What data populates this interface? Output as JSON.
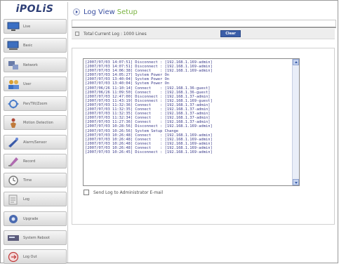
{
  "logo": "iPOLiS",
  "sidebar": {
    "items": [
      {
        "label": "Live",
        "icon": "monitor-icon",
        "color": "#3a6fc4"
      },
      {
        "label": "Basic",
        "icon": "computer-icon",
        "color": "#3d6fbf"
      },
      {
        "label": "Network",
        "icon": "network-icon",
        "color": "#6a7ca8"
      },
      {
        "label": "User",
        "icon": "users-icon",
        "color": "#d9a032"
      },
      {
        "label": "Pan/Tilt/Zoom",
        "icon": "ptz-icon",
        "color": "#4a7cc9"
      },
      {
        "label": "Motion Detection",
        "icon": "motion-icon",
        "color": "#b04a3a"
      },
      {
        "label": "Alarm/Sensor",
        "icon": "alarm-icon",
        "color": "#3a5aa8"
      },
      {
        "label": "Record",
        "icon": "record-icon",
        "color": "#b06ab0"
      },
      {
        "label": "Time",
        "icon": "clock-icon",
        "color": "#7a7a7a"
      },
      {
        "label": "Log",
        "icon": "log-icon",
        "color": "#9a9a9a"
      },
      {
        "label": "Upgrade",
        "icon": "upgrade-icon",
        "color": "#4a6ab0"
      },
      {
        "label": "System Reboot",
        "icon": "reboot-icon",
        "color": "#5a5a7a"
      },
      {
        "label": "Log Out",
        "icon": "logout-icon",
        "color": "#c03a3a"
      }
    ]
  },
  "header": {
    "title_part1": "Log View",
    "title_part2": "Setup"
  },
  "status": {
    "total_label": "Total Current Log : 1000 Lines",
    "clear_label": "Clear"
  },
  "log": {
    "lines": [
      "[2007/07/03 14:07:51] Disconnect : [192.168.1.169-admin]",
      "[2007/07/03 14:07:51] Disconnect : [192.168.1.169-admin]",
      "[2007/07/03 14:06:38] Connect    : [192.168.1.169-admin]",
      "[2007/07/03 14:05:27] System Power On",
      "[2007/07/03 13:40:04] System Power On",
      "[2007/07/03 13:40:04] System Power On",
      "[2007/06/26 11:10:14] Connect    : [192.168.1.36-guest]",
      "[2007/06/26 11:09:50] Connect    : [192.168.1.36-guest]",
      "[2007/07/03 12:47:00] Disconnect : [192.168.1.37-admin]",
      "[2007/07/03 11:43:19] Disconnect : [192.168.1.169-guest]",
      "[2007/07/03 11:32:36] Connect    : [192.168.1.37-admin]",
      "[2007/07/03 11:32:35] Connect    : [192.168.1.37-admin]",
      "[2007/07/03 11:32:35] Connect    : [192.168.1.37-admin]",
      "[2007/07/03 11:32:34] Connect    : [192.168.1.37-admin]",
      "[2007/07/03 11:27:36] Connect    : [192.168.1.37-admin]",
      "[2007/07/03 10:28:56] Disconnect : [192.168.1.169-admin]",
      "[2007/07/03 10:26:56] System Setup Change",
      "[2007/07/03 10:26:48] Connect    : [192.168.1.169-admin]",
      "[2007/07/03 10:26:48] Connect    : [192.168.1.169-admin]",
      "[2007/07/03 10:26:48] Connect    : [192.168.1.169-admin]",
      "[2007/07/03 10:26:48] Connect    : [192.168.1.169-admin]",
      "[2007/07/03 10:26:45] Disconnect : [192.168.1.169-admin]"
    ]
  },
  "email": {
    "label": "Send Log to Administrator E-mail",
    "checked": false
  }
}
